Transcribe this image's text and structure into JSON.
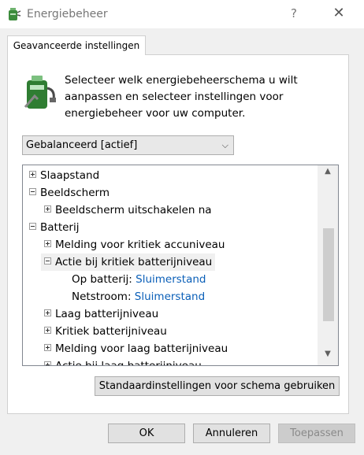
{
  "window": {
    "title": "Energiebeheer",
    "help_label": "?",
    "close_label": "✕"
  },
  "tab": {
    "label": "Geavanceerde instellingen"
  },
  "intro": {
    "line1": "Selecteer welk energiebeheerschema u wilt",
    "line2": "aanpassen en selecteer instellingen voor",
    "line3": "energiebeheer voor uw computer."
  },
  "scheme_select": {
    "value": "Gebalanceerd [actief]"
  },
  "tree": {
    "rows": [
      {
        "label": "Slaapstand",
        "level": 0,
        "expander": "plus"
      },
      {
        "label": "Beeldscherm",
        "level": 0,
        "expander": "minus"
      },
      {
        "label": "Beeldscherm uitschakelen na",
        "level": 1,
        "expander": "plus"
      },
      {
        "label": "Batterij",
        "level": 0,
        "expander": "minus"
      },
      {
        "label": "Melding voor kritiek accuniveau",
        "level": 1,
        "expander": "plus"
      },
      {
        "label": "Actie bij kritiek batterijniveau",
        "level": 1,
        "expander": "minus",
        "selected": true
      },
      {
        "label": "Op batterij:",
        "level": 2,
        "value": "Sluimerstand"
      },
      {
        "label": "Netstroom:",
        "level": 2,
        "value": "Sluimerstand"
      },
      {
        "label": "Laag batterijniveau",
        "level": 1,
        "expander": "plus"
      },
      {
        "label": "Kritiek batterijniveau",
        "level": 1,
        "expander": "plus"
      },
      {
        "label": "Melding voor laag batterijniveau",
        "level": 1,
        "expander": "plus"
      },
      {
        "label": "Actie bij laag batterijniveau",
        "level": 1,
        "expander": "plus"
      }
    ],
    "scroll": {
      "thumb_start": 0.28,
      "thumb_end": 0.83
    }
  },
  "buttons": {
    "restore_defaults": "Standaardinstellingen voor schema gebruiken",
    "ok": "OK",
    "cancel": "Annuleren",
    "apply": "Toepassen"
  },
  "colors": {
    "link": "#0a5fb8",
    "selected_row": "#f0f0f0"
  }
}
